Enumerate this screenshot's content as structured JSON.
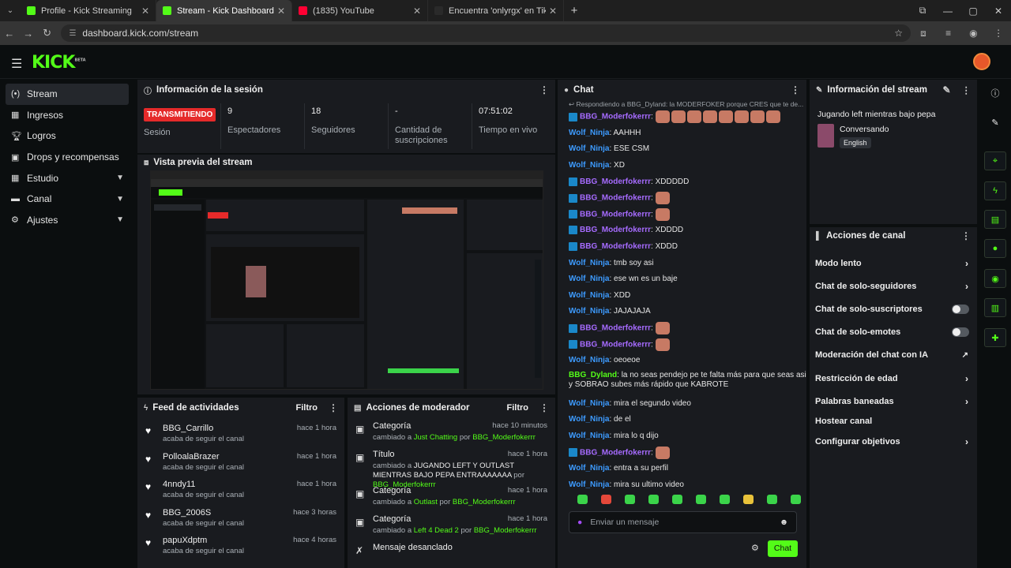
{
  "browser": {
    "tabs": [
      {
        "label": "Profile - Kick Streaming",
        "favicon_color": "#53fc18"
      },
      {
        "label": "Stream - Kick Dashboard",
        "favicon_color": "#53fc18"
      },
      {
        "label": "(1835) YouTube",
        "favicon_color": "#ff0033"
      },
      {
        "label": "Encuentra 'onlyrgx' en TikTok |",
        "favicon_color": "#2a2a2a"
      }
    ],
    "url": "dashboard.kick.com/stream"
  },
  "header": {
    "logo": "KICK",
    "logo_sup": "BETA"
  },
  "nav": {
    "items": [
      {
        "label": "Stream",
        "icon": "broadcast-icon"
      },
      {
        "label": "Ingresos",
        "icon": "table-icon"
      },
      {
        "label": "Logros",
        "icon": "trophy-icon"
      },
      {
        "label": "Drops y recompensas",
        "icon": "gift-icon"
      },
      {
        "label": "Estudio",
        "icon": "grid-icon"
      },
      {
        "label": "Canal",
        "icon": "channel-icon"
      },
      {
        "label": "Ajustes",
        "icon": "gear-icon"
      }
    ]
  },
  "session": {
    "title": "Información de la sesión",
    "status": "TRANSMITIENDO",
    "status_label": "Sesión",
    "viewers_value": "9",
    "viewers_label": "Espectadores",
    "followers_value": "18",
    "followers_label": "Seguidores",
    "subs_value": "-",
    "subs_label": "Cantidad de suscripciones",
    "time_value": "07:51:02",
    "time_label": "Tiempo en vivo"
  },
  "preview": {
    "title": "Vista previa del stream"
  },
  "feed": {
    "title": "Feed de actividades",
    "filter": "Filtro",
    "items": [
      {
        "name": "BBG_Carrillo",
        "action": "acaba de seguir el canal",
        "time": "hace 1 hora"
      },
      {
        "name": "PolloalaBrazer",
        "action": "acaba de seguir el canal",
        "time": "hace 1 hora"
      },
      {
        "name": "4nndy11",
        "action": "acaba de seguir el canal",
        "time": "hace 1 hora"
      },
      {
        "name": "BBG_2006S",
        "action": "acaba de seguir el canal",
        "time": "hace 3 horas"
      },
      {
        "name": "papuXdptm",
        "action": "acaba de seguir el canal",
        "time": "hace 4 horas"
      }
    ]
  },
  "modactions": {
    "title": "Acciones de moderador",
    "filter": "Filtro",
    "items": [
      {
        "title": "Categoría",
        "prefix": "cambiado a ",
        "value": "Just Chatting",
        "by": " por ",
        "user": "BBG_Moderfokerrr",
        "time": "hace 10 minutos"
      },
      {
        "title": "Título",
        "prefix": "cambiado a ",
        "value": "JUGANDO LEFT Y OUTLAST MIENTRAS BAJO PEPA ENTRAAAAAAA",
        "by": " por ",
        "user": "BBG_Moderfokerrr",
        "time": "hace 1 hora"
      },
      {
        "title": "Categoría",
        "prefix": "cambiado a ",
        "value": "Outlast",
        "by": " por ",
        "user": "BBG_Moderfokerrr",
        "time": "hace 1 hora"
      },
      {
        "title": "Categoría",
        "prefix": "cambiado a ",
        "value": "Left 4 Dead 2",
        "by": " por ",
        "user": "BBG_Moderfokerrr",
        "time": "hace 1 hora"
      },
      {
        "title": "Mensaje desanclado",
        "prefix": "",
        "value": "",
        "by": "",
        "user": "",
        "time": ""
      }
    ]
  },
  "chat": {
    "title": "Chat",
    "reply_text": "Respondiendo a BBG_Dyland: la MODERFOKER porque CRES que te de...",
    "placeholder": "Enviar un mensaje",
    "send": "Chat",
    "user_colors": {
      "mod": "#a66bff",
      "wolf": "#3d9bff",
      "dyland": "#53fc18"
    },
    "messages": [
      {
        "user": "BBG_Moderfokerrr",
        "kind": "mod",
        "text": "",
        "emotes": 8
      },
      {
        "user": "Wolf_Ninja",
        "kind": "wolf",
        "text": "AAHHH",
        "emotes": 0
      },
      {
        "user": "Wolf_Ninja",
        "kind": "wolf",
        "text": "ESE CSM",
        "emotes": 0
      },
      {
        "user": "Wolf_Ninja",
        "kind": "wolf",
        "text": "XD",
        "emotes": 0
      },
      {
        "user": "BBG_Moderfokerrr",
        "kind": "mod",
        "text": "XDDDDD",
        "emotes": 0
      },
      {
        "user": "BBG_Moderfokerrr",
        "kind": "mod",
        "text": "",
        "emotes": 1
      },
      {
        "user": "BBG_Moderfokerrr",
        "kind": "mod",
        "text": "",
        "emotes": 1
      },
      {
        "user": "BBG_Moderfokerrr",
        "kind": "mod",
        "text": "XDDDD",
        "emotes": 0
      },
      {
        "user": "BBG_Moderfokerrr",
        "kind": "mod",
        "text": "XDDD",
        "emotes": 0
      },
      {
        "user": "Wolf_Ninja",
        "kind": "wolf",
        "text": "tmb soy asi",
        "emotes": 0
      },
      {
        "user": "Wolf_Ninja",
        "kind": "wolf",
        "text": "ese wn es un baje",
        "emotes": 0
      },
      {
        "user": "Wolf_Ninja",
        "kind": "wolf",
        "text": "XDD",
        "emotes": 0
      },
      {
        "user": "Wolf_Ninja",
        "kind": "wolf",
        "text": "JAJAJAJA",
        "emotes": 0
      },
      {
        "user": "BBG_Moderfokerrr",
        "kind": "mod",
        "text": "",
        "emotes": 1
      },
      {
        "user": "BBG_Moderfokerrr",
        "kind": "mod",
        "text": "",
        "emotes": 1
      },
      {
        "user": "Wolf_Ninja",
        "kind": "wolf",
        "text": "oeoeoe",
        "emotes": 0
      },
      {
        "user": "BBG_Dyland",
        "kind": "dyland",
        "text": "la no seas pendejo pe te falta más para que seas asi y SOBRAO subes más rápido que KABROTE",
        "emotes": 0
      },
      {
        "user": "Wolf_Ninja",
        "kind": "wolf",
        "text": "mira el segundo video",
        "emotes": 0
      },
      {
        "user": "Wolf_Ninja",
        "kind": "wolf",
        "text": "de el",
        "emotes": 0
      },
      {
        "user": "Wolf_Ninja",
        "kind": "wolf",
        "text": "mira lo q dijo",
        "emotes": 0
      },
      {
        "user": "BBG_Moderfokerrr",
        "kind": "mod",
        "text": "",
        "emotes": 1
      },
      {
        "user": "Wolf_Ninja",
        "kind": "wolf",
        "text": "entra a su perfil",
        "emotes": 0
      },
      {
        "user": "Wolf_Ninja",
        "kind": "wolf",
        "text": "mira su ultimo video",
        "emotes": 0
      }
    ]
  },
  "streaminfo": {
    "title": "Información del stream",
    "stream_title": "Jugando left mientras bajo pepa",
    "category": "Conversando",
    "language": "English"
  },
  "channelactions": {
    "title": "Acciones de canal",
    "items": [
      {
        "label": "Modo lento",
        "control": "arrow"
      },
      {
        "label": "Chat de solo-seguidores",
        "control": "arrow"
      },
      {
        "label": "Chat de solo-suscriptores",
        "control": "toggle"
      },
      {
        "label": "Chat de solo-emotes",
        "control": "toggle"
      },
      {
        "label": "Moderación del chat con IA",
        "control": "external"
      },
      {
        "label": "Restricción de edad",
        "control": "arrow"
      },
      {
        "label": "Palabras baneadas",
        "control": "arrow"
      },
      {
        "label": "Hostear canal",
        "control": "none"
      },
      {
        "label": "Configurar objetivos",
        "control": "arrow"
      }
    ]
  }
}
